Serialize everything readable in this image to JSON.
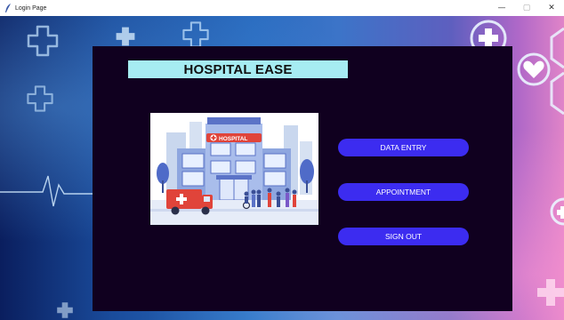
{
  "window": {
    "title": "Login Page",
    "controls": {
      "minimize": "—",
      "maximize": "▢",
      "close": "✕"
    }
  },
  "header": {
    "title": "HOSPITAL EASE"
  },
  "illustration": {
    "sign_text": "HOSPITAL"
  },
  "menu": {
    "data_entry": "DATA ENTRY",
    "appointment": "APPOINTMENT",
    "sign_out": "SIGN OUT"
  },
  "colors": {
    "panel": "#10001f",
    "banner": "#a6ecf2",
    "button": "#3c2cf0"
  }
}
